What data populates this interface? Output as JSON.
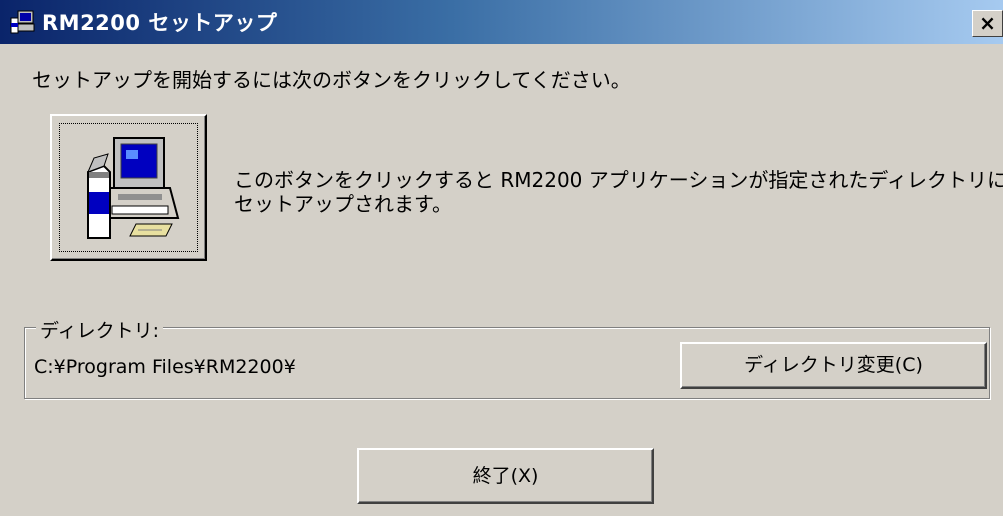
{
  "window": {
    "title": "RM2200 セットアップ",
    "close_label": "×",
    "colors": {
      "title_start": "#0a246a",
      "title_end": "#a6caf0",
      "face": "#d4d0c8"
    }
  },
  "instruction": "セットアップを開始するには次のボタンをクリックしてください。",
  "setup_button": {
    "icon": "computer-setup-icon",
    "description_line1": "このボタンをクリックすると RM2200 アプリケーションが指定されたディレクトリに",
    "description_line2": "セットアップされます。"
  },
  "directory": {
    "label": "ディレクトリ:",
    "path": "C:¥Program Files¥RM2200¥",
    "change_button": "ディレクトリ変更(C)"
  },
  "exit_button": "終了(X)"
}
